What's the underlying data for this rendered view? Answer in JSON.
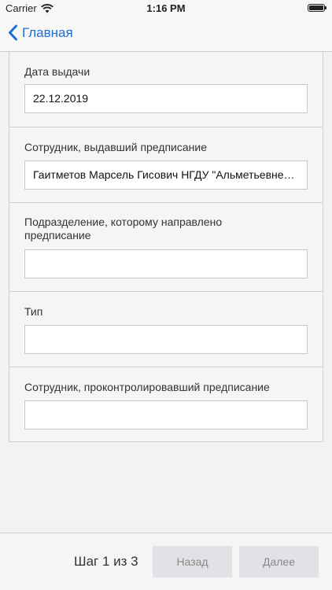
{
  "status_bar": {
    "carrier": "Carrier",
    "time": "1:16 PM"
  },
  "nav": {
    "back_label": "Главная"
  },
  "form": {
    "fields": [
      {
        "label": "Дата выдачи",
        "value": "22.12.2019"
      },
      {
        "label": "Сотрудник, выдавший предписание",
        "value": "Гаитметов Марсель Гисович НГДУ \"Альметьевнефть\""
      },
      {
        "label": "Подразделение, которому направлено предписание",
        "value": ""
      },
      {
        "label": "Тип",
        "value": ""
      },
      {
        "label": "Сотрудник, проконтролировавший предписание",
        "value": ""
      }
    ]
  },
  "footer": {
    "step_label": "Шаг 1 из 3",
    "back_button": "Назад",
    "next_button": "Далее"
  },
  "colors": {
    "accent": "#1f6fd6",
    "button_bg": "#e1e1e6",
    "button_text": "#888888"
  }
}
